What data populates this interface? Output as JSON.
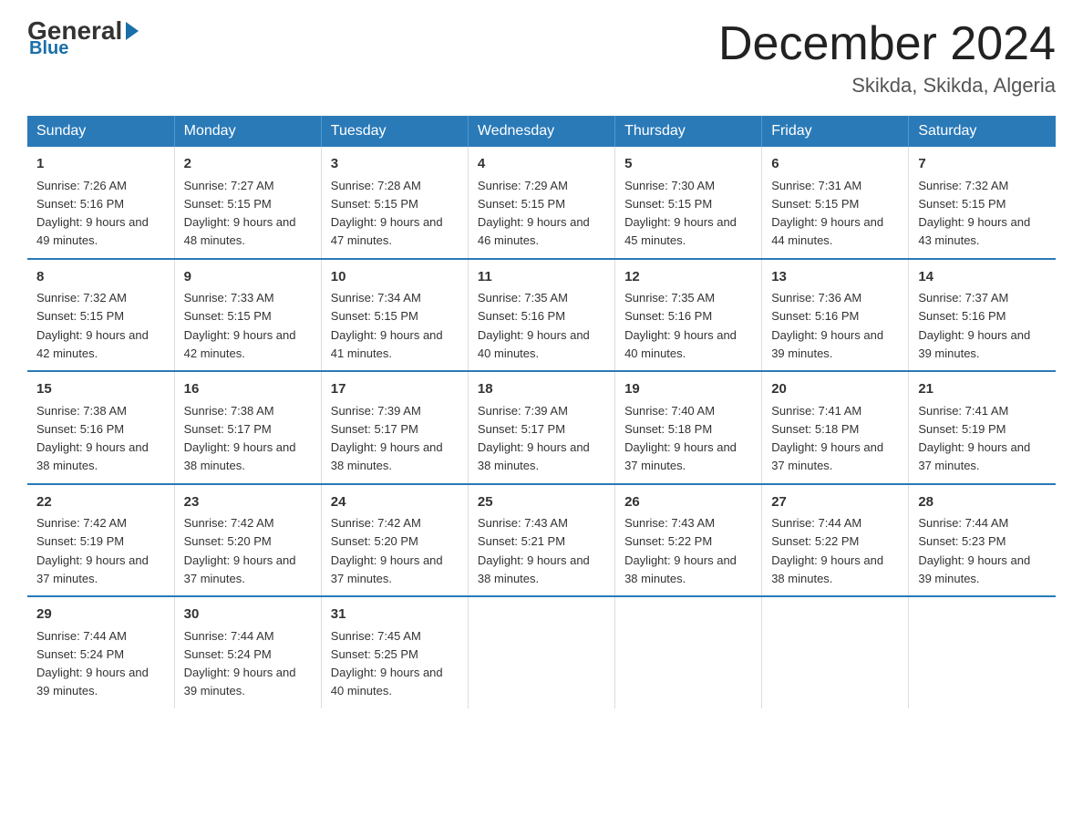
{
  "logo": {
    "general": "General",
    "blue": "Blue"
  },
  "title": "December 2024",
  "location": "Skikda, Skikda, Algeria",
  "days_of_week": [
    "Sunday",
    "Monday",
    "Tuesday",
    "Wednesday",
    "Thursday",
    "Friday",
    "Saturday"
  ],
  "weeks": [
    [
      {
        "day": "1",
        "sunrise": "7:26 AM",
        "sunset": "5:16 PM",
        "daylight": "9 hours and 49 minutes."
      },
      {
        "day": "2",
        "sunrise": "7:27 AM",
        "sunset": "5:15 PM",
        "daylight": "9 hours and 48 minutes."
      },
      {
        "day": "3",
        "sunrise": "7:28 AM",
        "sunset": "5:15 PM",
        "daylight": "9 hours and 47 minutes."
      },
      {
        "day": "4",
        "sunrise": "7:29 AM",
        "sunset": "5:15 PM",
        "daylight": "9 hours and 46 minutes."
      },
      {
        "day": "5",
        "sunrise": "7:30 AM",
        "sunset": "5:15 PM",
        "daylight": "9 hours and 45 minutes."
      },
      {
        "day": "6",
        "sunrise": "7:31 AM",
        "sunset": "5:15 PM",
        "daylight": "9 hours and 44 minutes."
      },
      {
        "day": "7",
        "sunrise": "7:32 AM",
        "sunset": "5:15 PM",
        "daylight": "9 hours and 43 minutes."
      }
    ],
    [
      {
        "day": "8",
        "sunrise": "7:32 AM",
        "sunset": "5:15 PM",
        "daylight": "9 hours and 42 minutes."
      },
      {
        "day": "9",
        "sunrise": "7:33 AM",
        "sunset": "5:15 PM",
        "daylight": "9 hours and 42 minutes."
      },
      {
        "day": "10",
        "sunrise": "7:34 AM",
        "sunset": "5:15 PM",
        "daylight": "9 hours and 41 minutes."
      },
      {
        "day": "11",
        "sunrise": "7:35 AM",
        "sunset": "5:16 PM",
        "daylight": "9 hours and 40 minutes."
      },
      {
        "day": "12",
        "sunrise": "7:35 AM",
        "sunset": "5:16 PM",
        "daylight": "9 hours and 40 minutes."
      },
      {
        "day": "13",
        "sunrise": "7:36 AM",
        "sunset": "5:16 PM",
        "daylight": "9 hours and 39 minutes."
      },
      {
        "day": "14",
        "sunrise": "7:37 AM",
        "sunset": "5:16 PM",
        "daylight": "9 hours and 39 minutes."
      }
    ],
    [
      {
        "day": "15",
        "sunrise": "7:38 AM",
        "sunset": "5:16 PM",
        "daylight": "9 hours and 38 minutes."
      },
      {
        "day": "16",
        "sunrise": "7:38 AM",
        "sunset": "5:17 PM",
        "daylight": "9 hours and 38 minutes."
      },
      {
        "day": "17",
        "sunrise": "7:39 AM",
        "sunset": "5:17 PM",
        "daylight": "9 hours and 38 minutes."
      },
      {
        "day": "18",
        "sunrise": "7:39 AM",
        "sunset": "5:17 PM",
        "daylight": "9 hours and 38 minutes."
      },
      {
        "day": "19",
        "sunrise": "7:40 AM",
        "sunset": "5:18 PM",
        "daylight": "9 hours and 37 minutes."
      },
      {
        "day": "20",
        "sunrise": "7:41 AM",
        "sunset": "5:18 PM",
        "daylight": "9 hours and 37 minutes."
      },
      {
        "day": "21",
        "sunrise": "7:41 AM",
        "sunset": "5:19 PM",
        "daylight": "9 hours and 37 minutes."
      }
    ],
    [
      {
        "day": "22",
        "sunrise": "7:42 AM",
        "sunset": "5:19 PM",
        "daylight": "9 hours and 37 minutes."
      },
      {
        "day": "23",
        "sunrise": "7:42 AM",
        "sunset": "5:20 PM",
        "daylight": "9 hours and 37 minutes."
      },
      {
        "day": "24",
        "sunrise": "7:42 AM",
        "sunset": "5:20 PM",
        "daylight": "9 hours and 37 minutes."
      },
      {
        "day": "25",
        "sunrise": "7:43 AM",
        "sunset": "5:21 PM",
        "daylight": "9 hours and 38 minutes."
      },
      {
        "day": "26",
        "sunrise": "7:43 AM",
        "sunset": "5:22 PM",
        "daylight": "9 hours and 38 minutes."
      },
      {
        "day": "27",
        "sunrise": "7:44 AM",
        "sunset": "5:22 PM",
        "daylight": "9 hours and 38 minutes."
      },
      {
        "day": "28",
        "sunrise": "7:44 AM",
        "sunset": "5:23 PM",
        "daylight": "9 hours and 39 minutes."
      }
    ],
    [
      {
        "day": "29",
        "sunrise": "7:44 AM",
        "sunset": "5:24 PM",
        "daylight": "9 hours and 39 minutes."
      },
      {
        "day": "30",
        "sunrise": "7:44 AM",
        "sunset": "5:24 PM",
        "daylight": "9 hours and 39 minutes."
      },
      {
        "day": "31",
        "sunrise": "7:45 AM",
        "sunset": "5:25 PM",
        "daylight": "9 hours and 40 minutes."
      },
      null,
      null,
      null,
      null
    ]
  ]
}
